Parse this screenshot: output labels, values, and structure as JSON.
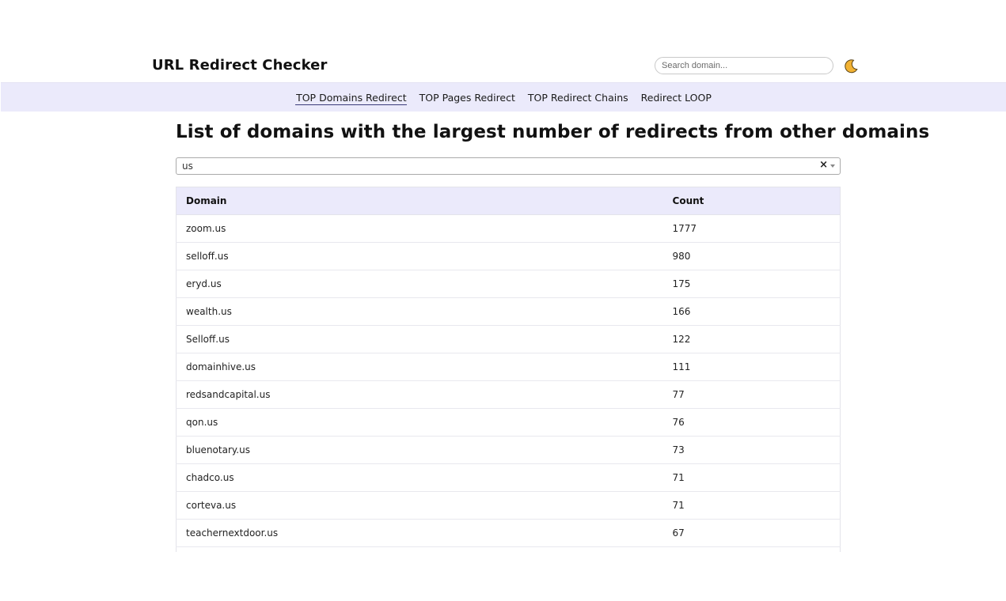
{
  "header": {
    "title": "URL Redirect Checker",
    "search_placeholder": "Search domain...",
    "theme_icon": "moon-icon"
  },
  "nav": {
    "items": [
      {
        "label": "TOP Domains Redirect",
        "active": true
      },
      {
        "label": "TOP Pages Redirect",
        "active": false
      },
      {
        "label": "TOP Redirect Chains",
        "active": false
      },
      {
        "label": "Redirect LOOP",
        "active": false
      }
    ]
  },
  "main": {
    "heading": "List of domains with the largest number of redirects from other domains",
    "filter": {
      "value": "us",
      "clear_label": "×"
    },
    "table": {
      "columns": [
        "Domain",
        "Count"
      ],
      "rows": [
        {
          "domain": "zoom.us",
          "count": "1777"
        },
        {
          "domain": "selloff.us",
          "count": "980"
        },
        {
          "domain": "eryd.us",
          "count": "175"
        },
        {
          "domain": "wealth.us",
          "count": "166"
        },
        {
          "domain": "Selloff.us",
          "count": "122"
        },
        {
          "domain": "domainhive.us",
          "count": "111"
        },
        {
          "domain": "redsandcapital.us",
          "count": "77"
        },
        {
          "domain": "qon.us",
          "count": "76"
        },
        {
          "domain": "bluenotary.us",
          "count": "73"
        },
        {
          "domain": "chadco.us",
          "count": "71"
        },
        {
          "domain": "corteva.us",
          "count": "71"
        },
        {
          "domain": "teachernextdoor.us",
          "count": "67"
        }
      ]
    }
  },
  "colors": {
    "accent_bg": "#ebeafb",
    "moon": "#f2b233"
  }
}
